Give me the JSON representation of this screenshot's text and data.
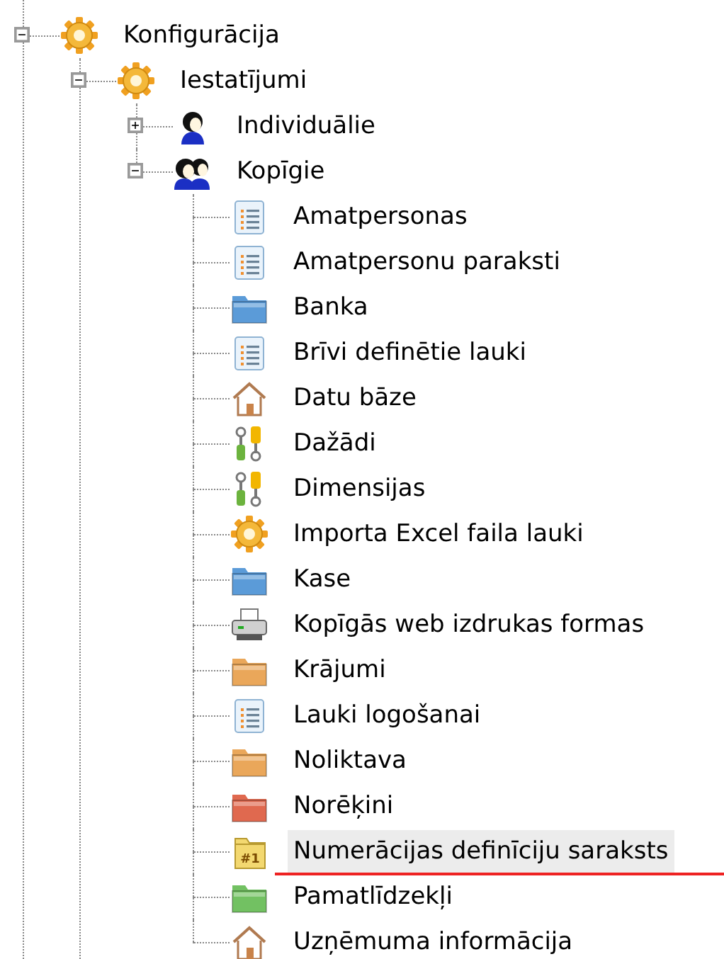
{
  "tree": [
    {
      "label": "Konfigurācija",
      "kind": "gear",
      "expanded": true,
      "selected": false,
      "children": [
        {
          "label": "Iestatījumi",
          "kind": "gear",
          "expanded": true,
          "selected": false,
          "children": [
            {
              "label": "Individuālie",
              "kind": "person",
              "expanded": false,
              "selected": false
            },
            {
              "label": "Kopīgie",
              "kind": "people",
              "expanded": true,
              "selected": false,
              "children": [
                {
                  "label": "Amatpersonas",
                  "kind": "list",
                  "selected": false
                },
                {
                  "label": "Amatpersonu paraksti",
                  "kind": "list",
                  "selected": false
                },
                {
                  "label": "Banka",
                  "kind": "folder",
                  "color": "#5b9bd8",
                  "selected": false
                },
                {
                  "label": "Brīvi definētie lauki",
                  "kind": "list",
                  "selected": false
                },
                {
                  "label": "Datu bāze",
                  "kind": "house",
                  "selected": false
                },
                {
                  "label": "Dažādi",
                  "kind": "tools",
                  "selected": false
                },
                {
                  "label": "Dimensijas",
                  "kind": "tools",
                  "selected": false
                },
                {
                  "label": "Importa Excel faila lauki",
                  "kind": "gear",
                  "selected": false
                },
                {
                  "label": "Kase",
                  "kind": "folder",
                  "color": "#5b9bd8",
                  "selected": false
                },
                {
                  "label": "Kopīgās web izdrukas formas",
                  "kind": "printer",
                  "selected": false
                },
                {
                  "label": "Krājumi",
                  "kind": "folder",
                  "color": "#eaa75a",
                  "selected": false
                },
                {
                  "label": "Lauki logošanai",
                  "kind": "list",
                  "selected": false
                },
                {
                  "label": "Noliktava",
                  "kind": "folder",
                  "color": "#eaa75a",
                  "selected": false
                },
                {
                  "label": "Norēķini",
                  "kind": "folder",
                  "color": "#e0694f",
                  "selected": false
                },
                {
                  "label": "Numerācijas definīciju saraksts",
                  "kind": "numbered",
                  "badge": "#1",
                  "selected": true,
                  "underlined": true
                },
                {
                  "label": "Pamatlīdzekļi",
                  "kind": "folder",
                  "color": "#72c162",
                  "selected": false
                },
                {
                  "label": "Uzņēmuma informācija",
                  "kind": "house",
                  "selected": false
                }
              ]
            }
          ]
        }
      ]
    }
  ]
}
